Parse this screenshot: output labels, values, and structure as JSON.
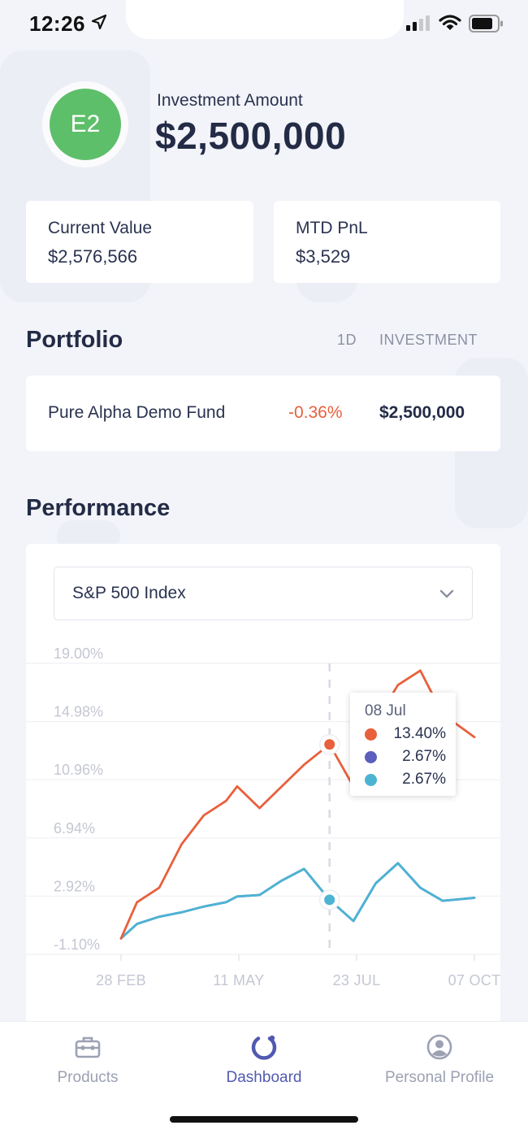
{
  "status_bar": {
    "time": "12:26",
    "icons": [
      "location-arrow-icon",
      "cellular-signal-icon",
      "wifi-icon",
      "battery-icon"
    ]
  },
  "header": {
    "avatar_initials": "E2",
    "avatar_color": "#5ebf6a",
    "investment_label": "Investment Amount",
    "investment_amount": "$2,500,000"
  },
  "summary": {
    "current_value_label": "Current Value",
    "current_value": "$2,576,566",
    "mtd_pnl_label": "MTD PnL",
    "mtd_pnl": "$3,529"
  },
  "portfolio": {
    "title": "Portfolio",
    "columns": [
      "1D",
      "INVESTMENT"
    ],
    "rows": [
      {
        "name": "Pure Alpha Demo Fund",
        "change_1d": "-0.36%",
        "investment": "$2,500,000"
      }
    ]
  },
  "performance": {
    "title": "Performance",
    "benchmark_selected": "S&P 500 Index",
    "tooltip": {
      "date": "08 Jul",
      "values": [
        {
          "value": "13.40%",
          "color": "#e8603c"
        },
        {
          "value": "2.67%",
          "color": "#5b5fbd"
        },
        {
          "value": "2.67%",
          "color": "#4cb3d3"
        }
      ]
    }
  },
  "chart_data": {
    "type": "line",
    "y_tick_labels": [
      "19.00%",
      "14.98%",
      "10.96%",
      "6.94%",
      "2.92%",
      "-1.10%"
    ],
    "x_tick_labels": [
      "28 FEB",
      "11 MAY",
      "23 JUL",
      "07 OCT"
    ],
    "ylim": [
      -1.1,
      19.0
    ],
    "grid": true,
    "x": [
      "2020-02-28",
      "2020-03-09",
      "2020-03-23",
      "2020-04-06",
      "2020-04-20",
      "2020-05-04",
      "2020-05-11",
      "2020-05-25",
      "2020-06-08",
      "2020-06-22",
      "2020-07-08",
      "2020-07-23",
      "2020-08-06",
      "2020-08-20",
      "2020-09-03",
      "2020-09-17",
      "2020-10-07"
    ],
    "series": [
      {
        "color": "#e8603c",
        "values": [
          0.0,
          2.5,
          3.5,
          6.5,
          8.5,
          9.5,
          10.5,
          9.0,
          10.5,
          12.0,
          13.4,
          10.5,
          15.0,
          17.5,
          18.5,
          15.5,
          13.9
        ]
      },
      {
        "color": "#5b5fbd",
        "values": [
          0.0,
          1.0,
          1.5,
          1.8,
          2.2,
          2.5,
          2.9,
          3.0,
          4.0,
          4.8,
          2.67,
          1.2,
          3.8,
          5.2,
          3.5,
          2.6,
          2.8
        ]
      },
      {
        "color": "#4cb3d3",
        "values": [
          0.0,
          1.0,
          1.5,
          1.8,
          2.2,
          2.5,
          2.9,
          3.0,
          4.0,
          4.8,
          2.67,
          1.2,
          3.8,
          5.2,
          3.5,
          2.6,
          2.8
        ]
      }
    ],
    "highlight_date": "2020-07-08"
  },
  "nav": {
    "items": [
      {
        "label": "Products"
      },
      {
        "label": "Dashboard"
      },
      {
        "label": "Personal Profile"
      }
    ],
    "active_color": "#5159b0",
    "inactive_color": "#9ca1b3"
  }
}
